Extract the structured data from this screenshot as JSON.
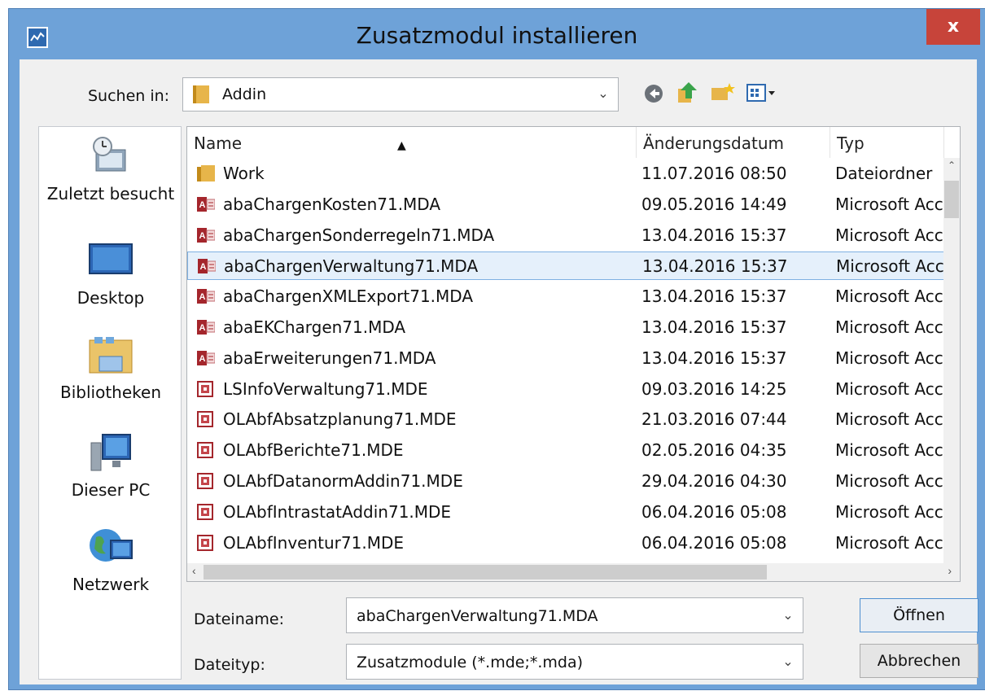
{
  "window": {
    "title": "Zusatzmodul installieren",
    "close_glyph": "x"
  },
  "lookin": {
    "label": "Suchen in:",
    "value": "Addin"
  },
  "places": [
    {
      "label": "Zuletzt besucht",
      "icon": "recent-places-icon"
    },
    {
      "label": "Desktop",
      "icon": "desktop-icon"
    },
    {
      "label": "Bibliotheken",
      "icon": "libraries-icon"
    },
    {
      "label": "Dieser PC",
      "icon": "computer-icon"
    },
    {
      "label": "Netzwerk",
      "icon": "network-icon"
    }
  ],
  "columns": {
    "name": "Name",
    "date": "Änderungsdatum",
    "type": "Typ"
  },
  "files": [
    {
      "name": "Work",
      "date": "11.07.2016 08:50",
      "type": "Dateiordner",
      "kind": "folder"
    },
    {
      "name": "abaChargenKosten71.MDA",
      "date": "09.05.2016 14:49",
      "type": "Microsoft Acc",
      "kind": "mda"
    },
    {
      "name": "abaChargenSonderregeln71.MDA",
      "date": "13.04.2016 15:37",
      "type": "Microsoft Acc",
      "kind": "mda"
    },
    {
      "name": "abaChargenVerwaltung71.MDA",
      "date": "13.04.2016 15:37",
      "type": "Microsoft Acc",
      "kind": "mda",
      "selected": true
    },
    {
      "name": "abaChargenXMLExport71.MDA",
      "date": "13.04.2016 15:37",
      "type": "Microsoft Acc",
      "kind": "mda"
    },
    {
      "name": "abaEKChargen71.MDA",
      "date": "13.04.2016 15:37",
      "type": "Microsoft Acc",
      "kind": "mda"
    },
    {
      "name": "abaErweiterungen71.MDA",
      "date": "13.04.2016 15:37",
      "type": "Microsoft Acc",
      "kind": "mda"
    },
    {
      "name": "LSInfoVerwaltung71.MDE",
      "date": "09.03.2016 14:25",
      "type": "Microsoft Acc",
      "kind": "mde"
    },
    {
      "name": "OLAbfAbsatzplanung71.MDE",
      "date": "21.03.2016 07:44",
      "type": "Microsoft Acc",
      "kind": "mde"
    },
    {
      "name": "OLAbfBerichte71.MDE",
      "date": "02.05.2016 04:35",
      "type": "Microsoft Acc",
      "kind": "mde"
    },
    {
      "name": "OLAbfDatanormAddin71.MDE",
      "date": "29.04.2016 04:30",
      "type": "Microsoft Acc",
      "kind": "mde"
    },
    {
      "name": "OLAbfIntrastatAddin71.MDE",
      "date": "06.04.2016 05:08",
      "type": "Microsoft Acc",
      "kind": "mde"
    },
    {
      "name": "OLAbfInventur71.MDE",
      "date": "06.04.2016 05:08",
      "type": "Microsoft Acc",
      "kind": "mde"
    }
  ],
  "filename": {
    "label": "Dateiname:",
    "value": "abaChargenVerwaltung71.MDA"
  },
  "filetype": {
    "label": "Dateityp:",
    "value": "Zusatzmodule (*.mde;*.mda)"
  },
  "buttons": {
    "open": "Öffnen",
    "cancel": "Abbrechen"
  },
  "colors": {
    "selection": "#e5f0fb",
    "title_bar": "#6ea2d8",
    "close": "#c7443a"
  }
}
